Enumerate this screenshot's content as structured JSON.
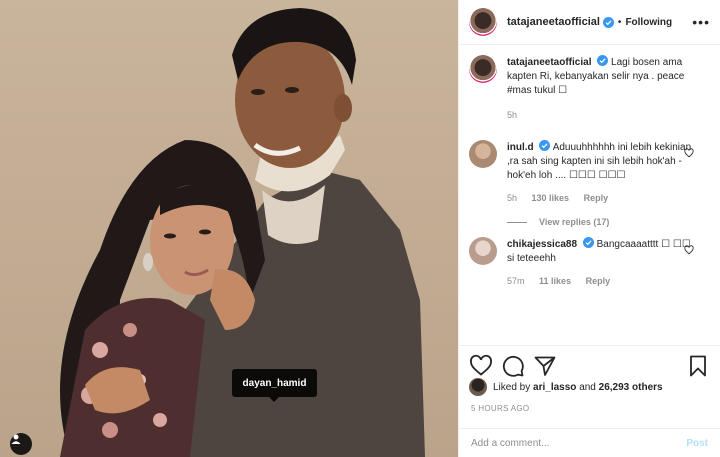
{
  "photo": {
    "tag_label": "dayan_hamid"
  },
  "header": {
    "username": "tatajaneetaofficial",
    "separator": "•",
    "follow_label": "Following",
    "more_label": "•••"
  },
  "caption": {
    "username": "tatajaneetaofficial",
    "text": "Lagi bosen ama kapten Ri, kebanyakan selir nya . peace #mas tukul ☐",
    "time": "5h"
  },
  "comments": [
    {
      "username": "inul.d",
      "text": "Aduuuhhhhhh ini lebih kekinian ,ra sah sing kapten ini sih lebih hok'ah - hok'eh loh .... ☐☐☐ ☐☐☐",
      "time": "5h",
      "likes": "130 likes",
      "reply": "Reply",
      "view_replies": "View replies (17)"
    },
    {
      "username": "chikajessica88",
      "text": "Bangcaaaatttt ☐ ☐☐ si teteeehh",
      "time": "57m",
      "likes": "11 likes",
      "reply": "Reply"
    }
  ],
  "likes": {
    "prefix": "Liked by",
    "user": "ari_lasso",
    "and": "and",
    "others": "26,293 others"
  },
  "timestamp": "5 HOURS AGO",
  "add_comment": {
    "placeholder": "Add a comment...",
    "post_label": "Post"
  },
  "colors": {
    "verified": "#3897f0",
    "muted": "#8e8e8e",
    "post_disabled": "#b2dffc"
  }
}
